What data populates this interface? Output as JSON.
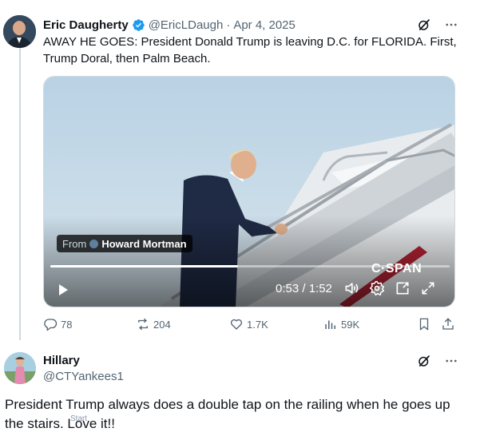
{
  "post": {
    "author_name": "Eric Daugherty",
    "author_handle": "@EricLDaugh",
    "date": "Apr 4, 2025",
    "separator": "·",
    "text": "AWAY HE GOES: President Donald Trump is leaving D.C. for FLORIDA. First, Trump Doral, then Palm Beach.",
    "verified": true,
    "verified_color": "#1d9bf0"
  },
  "video": {
    "from_prefix": "From",
    "from_author": "Howard Mortman",
    "time": "0:53 / 1:52",
    "progress_fraction": 0.47,
    "watermark": "C·SPAN",
    "icons": [
      "play-icon",
      "volume-icon",
      "settings-icon",
      "pip-icon",
      "fullscreen-icon"
    ]
  },
  "engagement": {
    "replies": "78",
    "reposts": "204",
    "likes": "1.7K",
    "views": "59K"
  },
  "reply": {
    "author_name": "Hillary",
    "author_handle": "@CTYankees1",
    "text": "President Trump always does a double tap on the railing when he goes up the stairs. Love it!!",
    "ghost_text": "Start"
  },
  "colors": {
    "text_primary": "#0f1419",
    "text_secondary": "#536471",
    "accent": "#1d9bf0",
    "thread_line": "#cfd9de"
  }
}
